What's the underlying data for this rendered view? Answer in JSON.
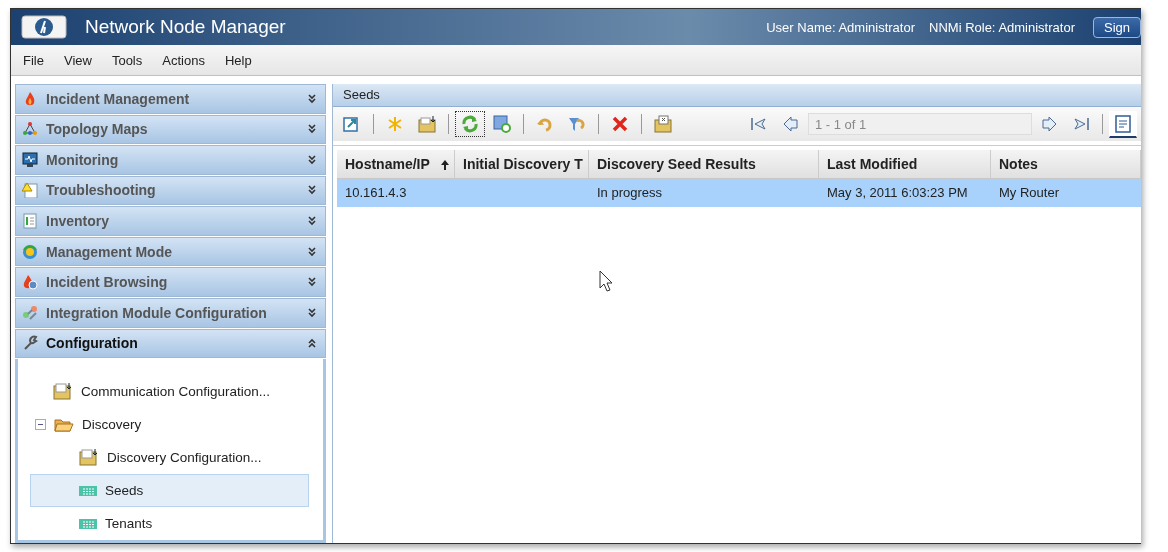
{
  "header": {
    "title": "Network Node Manager",
    "user": "User Name: Administrator",
    "role": "NNMi Role: Administrator",
    "sign_button": "Sign"
  },
  "menu": [
    "File",
    "View",
    "Tools",
    "Actions",
    "Help"
  ],
  "sidebar": [
    {
      "label": "Incident Management",
      "expanded": false
    },
    {
      "label": "Topology Maps",
      "expanded": false
    },
    {
      "label": "Monitoring",
      "expanded": false
    },
    {
      "label": "Troubleshooting",
      "expanded": false
    },
    {
      "label": "Inventory",
      "expanded": false
    },
    {
      "label": "Management Mode",
      "expanded": false
    },
    {
      "label": "Incident Browsing",
      "expanded": false
    },
    {
      "label": "Integration Module Configuration",
      "expanded": false
    },
    {
      "label": "Configuration",
      "expanded": true,
      "tree": [
        {
          "label": "Communication Configuration...",
          "kind": "form",
          "selected": false
        },
        {
          "label": "Discovery",
          "kind": "folder",
          "expanded": true,
          "selected": false,
          "children": [
            {
              "label": "Discovery Configuration...",
              "kind": "form",
              "selected": false
            },
            {
              "label": "Seeds",
              "kind": "table",
              "selected": true
            },
            {
              "label": "Tenants",
              "kind": "table",
              "selected": false
            }
          ]
        }
      ]
    }
  ],
  "tab": "Seeds",
  "toolbar": [
    {
      "focused": false
    },
    {
      "focused": false
    },
    {
      "focused": false
    },
    {
      "focused": true
    },
    {
      "focused": false
    },
    {
      "focused": false
    },
    {
      "focused": false
    },
    {
      "focused": false
    },
    {
      "focused": false
    }
  ],
  "pager": "1 - 1 of 1",
  "table": {
    "columns": [
      "Hostname/IP",
      "Initial Discovery T",
      "Discovery Seed Results",
      "Last Modified",
      "Notes"
    ],
    "rows": [
      {
        "cells": [
          "10.161.4.3",
          "",
          "In progress",
          "May 3, 2011 6:03:23 PM",
          "My Router"
        ],
        "selected": true
      }
    ]
  }
}
